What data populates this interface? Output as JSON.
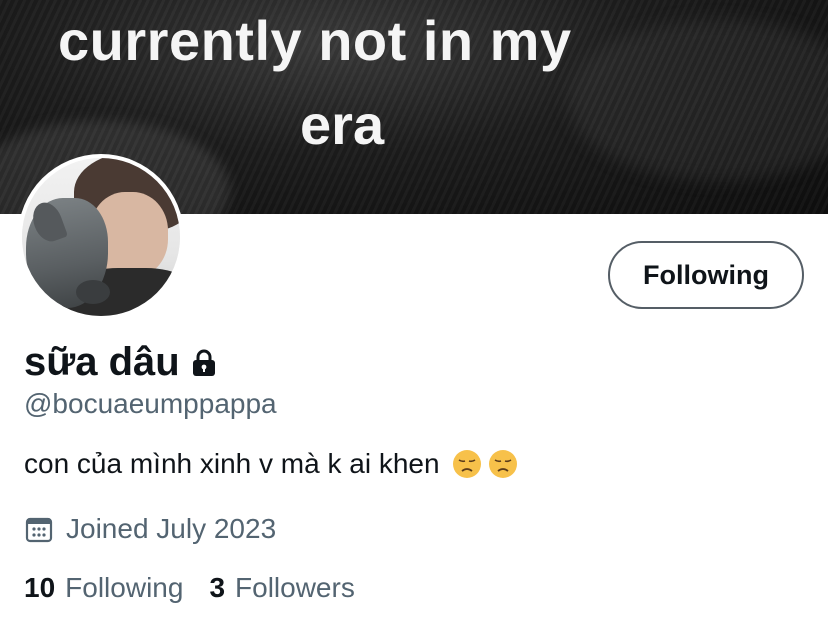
{
  "banner": {
    "line1": "currently not in my",
    "line2": "era"
  },
  "profile": {
    "display_name": "sữa dâu",
    "handle": "@bocuaeumppappa",
    "bio": "con của mình xinh v mà k ai khen",
    "bio_emojis": [
      "disappointed-face-emoji",
      "disappointed-face-emoji"
    ],
    "joined": "Joined July 2023",
    "locked_icon": "lock-icon",
    "calendar_icon": "calendar-icon"
  },
  "actions": {
    "follow_label": "Following"
  },
  "stats": {
    "following_count": "10",
    "following_label": "Following",
    "followers_count": "3",
    "followers_label": "Followers"
  },
  "colors": {
    "text_primary": "#0f1419",
    "text_secondary": "#536471",
    "button_border": "#555e66",
    "emoji_yellow": "#f7c14a"
  }
}
